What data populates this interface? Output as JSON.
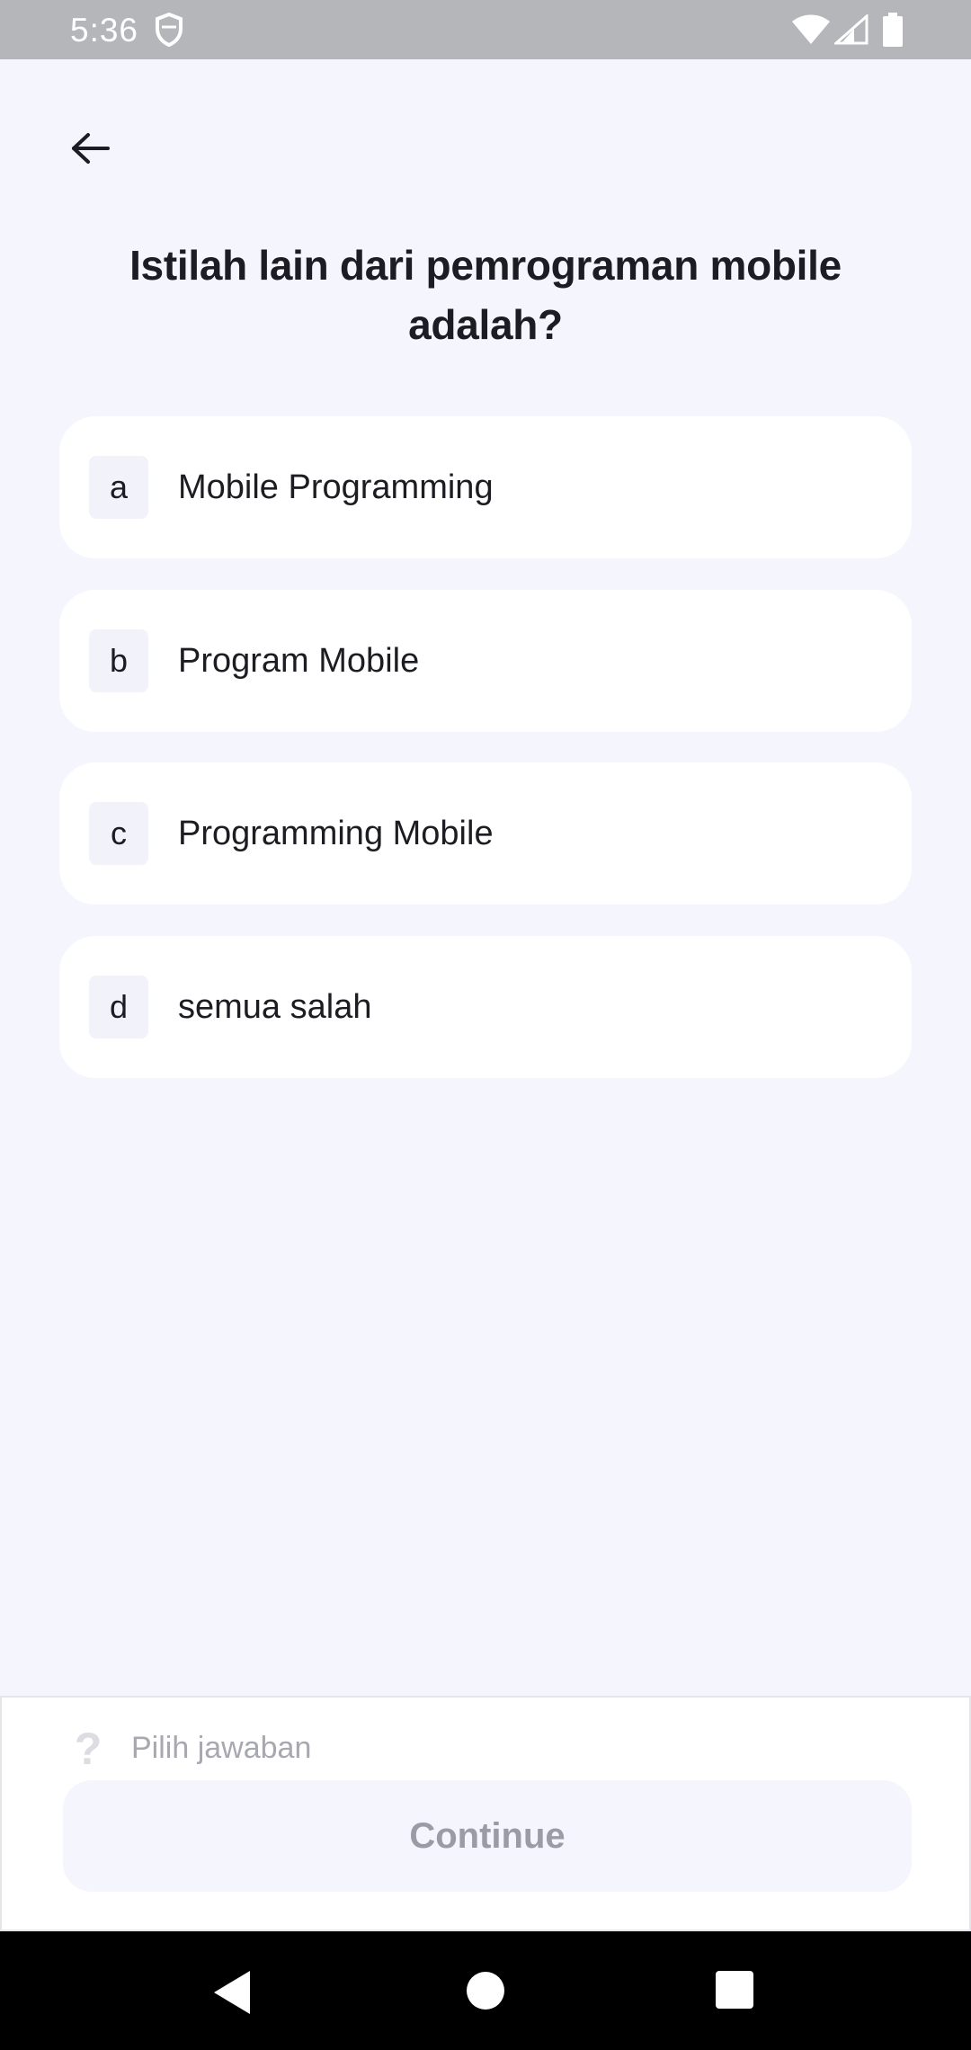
{
  "status_bar": {
    "time": "5:36"
  },
  "icons": {
    "app_notification": "shield-icon",
    "wifi": "wifi-icon",
    "signal": "signal-icon",
    "battery": "battery-icon",
    "back": "arrow-left-icon",
    "hint": "question-mark-icon"
  },
  "question": {
    "title": "Istilah lain dari pemrograman mobile adalah?"
  },
  "options": [
    {
      "letter": "a",
      "text": "Mobile Programming"
    },
    {
      "letter": "b",
      "text": "Program Mobile"
    },
    {
      "letter": "c",
      "text": "Programming Mobile"
    },
    {
      "letter": "d",
      "text": "semua salah"
    }
  ],
  "footer": {
    "hint_icon": "?",
    "hint": "Pilih jawaban",
    "continue_label": "Continue"
  },
  "colors": {
    "background": "#f5f5fe",
    "card": "#ffffff",
    "text_primary": "#1c1c22",
    "disabled_text": "#9b9ba6",
    "status_bar": "#b5b6ba"
  }
}
